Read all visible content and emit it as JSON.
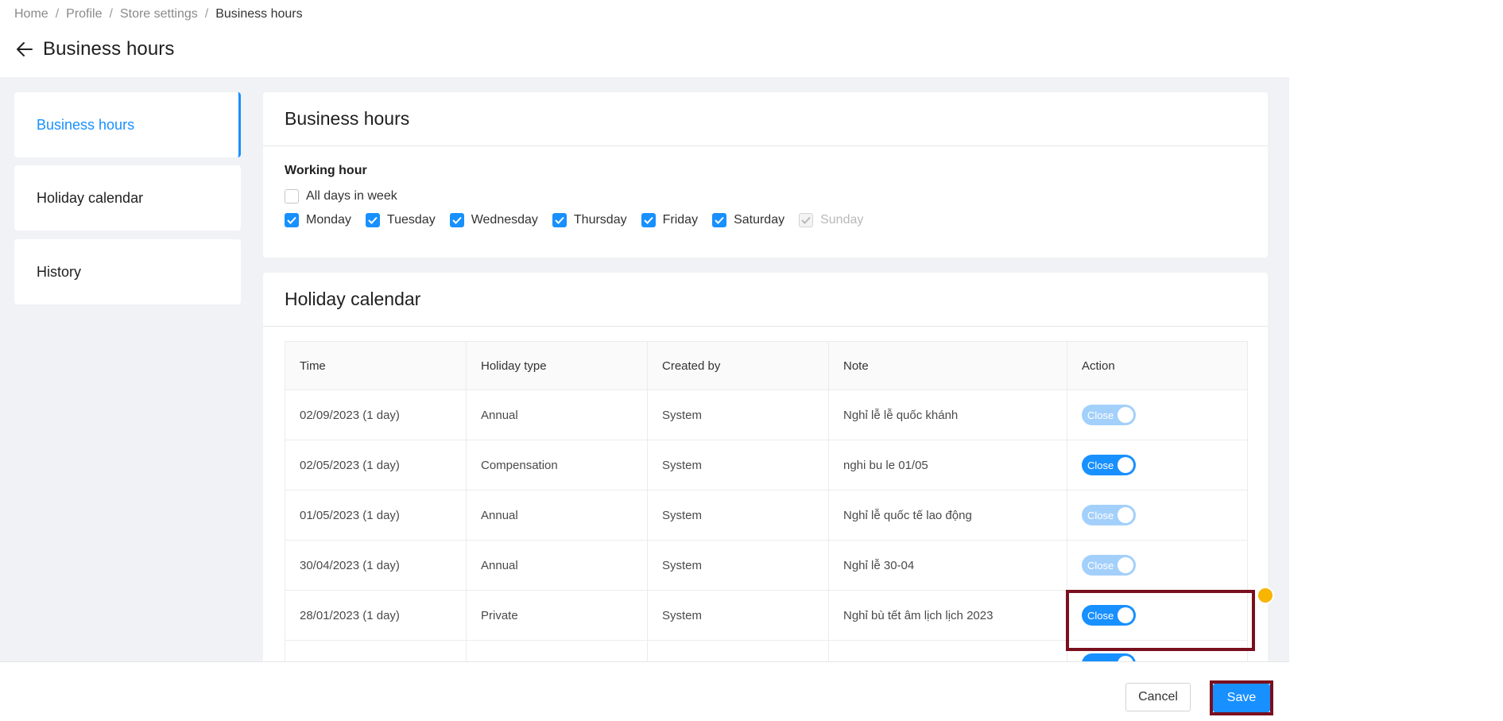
{
  "breadcrumb": [
    "Home",
    "Profile",
    "Store settings",
    "Business hours"
  ],
  "page_title": "Business hours",
  "sidebar": {
    "items": [
      {
        "label": "Business hours",
        "active": true
      },
      {
        "label": "Holiday calendar",
        "active": false
      },
      {
        "label": "History",
        "active": false
      }
    ]
  },
  "business_hours": {
    "title": "Business hours",
    "working_hour_label": "Working hour",
    "all_days_label": "All days in week",
    "all_days_checked": false,
    "days": [
      {
        "label": "Monday",
        "checked": true,
        "disabled": false
      },
      {
        "label": "Tuesday",
        "checked": true,
        "disabled": false
      },
      {
        "label": "Wednesday",
        "checked": true,
        "disabled": false
      },
      {
        "label": "Thursday",
        "checked": true,
        "disabled": false
      },
      {
        "label": "Friday",
        "checked": true,
        "disabled": false
      },
      {
        "label": "Saturday",
        "checked": true,
        "disabled": false
      },
      {
        "label": "Sunday",
        "checked": true,
        "disabled": true
      }
    ]
  },
  "holiday_calendar": {
    "title": "Holiday calendar",
    "columns": [
      "Time",
      "Holiday type",
      "Created by",
      "Note",
      "Action"
    ],
    "rows": [
      {
        "time": "02/09/2023 (1 day)",
        "type": "Annual",
        "created_by": "System",
        "note": "Nghỉ lễ lễ quốc khánh",
        "action": "Close",
        "enabled": false
      },
      {
        "time": "02/05/2023 (1 day)",
        "type": "Compensation",
        "created_by": "System",
        "note": "nghi bu le 01/05",
        "action": "Close",
        "enabled": true
      },
      {
        "time": "01/05/2023 (1 day)",
        "type": "Annual",
        "created_by": "System",
        "note": "Nghỉ lễ quốc tế lao động",
        "action": "Close",
        "enabled": false
      },
      {
        "time": "30/04/2023 (1 day)",
        "type": "Annual",
        "created_by": "System",
        "note": "Nghỉ lễ 30-04",
        "action": "Close",
        "enabled": false
      },
      {
        "time": "28/01/2023 (1 day)",
        "type": "Private",
        "created_by": "System",
        "note": "Nghỉ bù tết âm lịch lịch 2023",
        "action": "Close",
        "enabled": true
      }
    ]
  },
  "footer": {
    "cancel_label": "Cancel",
    "save_label": "Save"
  },
  "colors": {
    "accent": "#1890ff",
    "highlight": "#7a0f1e"
  }
}
